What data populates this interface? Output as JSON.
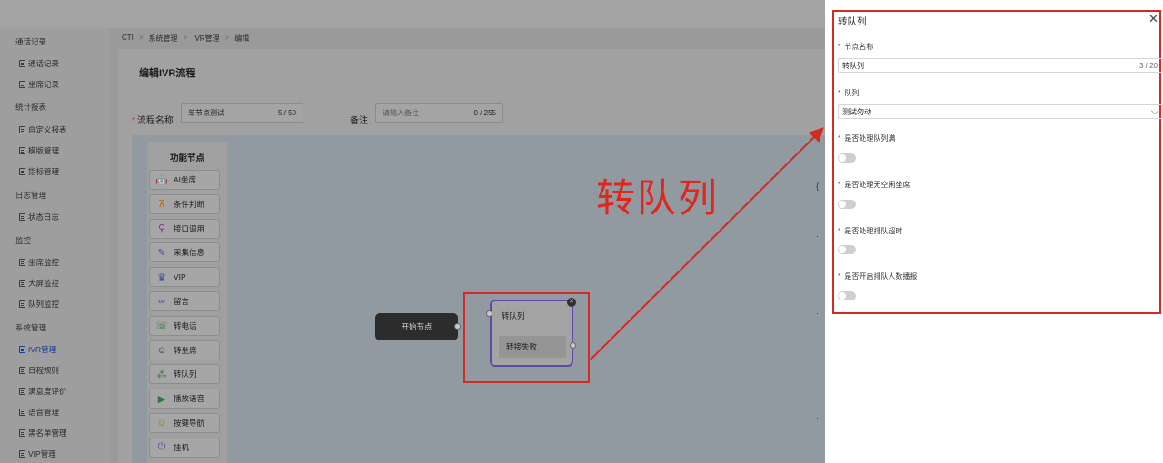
{
  "breadcrumb": [
    "CTI",
    "系统管理",
    "IVR管理",
    "编辑"
  ],
  "page_title": "编辑IVR流程",
  "sidebar": {
    "groups": [
      {
        "label": "通话记录",
        "items": [
          {
            "label": "通话记录"
          },
          {
            "label": "坐席记录"
          }
        ]
      },
      {
        "label": "统计报表",
        "items": [
          {
            "label": "自定义报表"
          },
          {
            "label": "模版管理"
          },
          {
            "label": "指标管理"
          }
        ]
      },
      {
        "label": "日志管理",
        "items": [
          {
            "label": "状态日志"
          }
        ]
      },
      {
        "label": "监控",
        "items": [
          {
            "label": "坐席监控"
          },
          {
            "label": "大屏监控"
          },
          {
            "label": "队列监控"
          }
        ]
      },
      {
        "label": "系统管理",
        "items": [
          {
            "label": "IVR管理",
            "active": true
          },
          {
            "label": "日程规则"
          },
          {
            "label": "满意度评价"
          },
          {
            "label": "语音管理"
          },
          {
            "label": "黑名单管理"
          },
          {
            "label": "VIP管理"
          }
        ]
      }
    ]
  },
  "form": {
    "flow_name_label": "流程名称",
    "flow_name_value": "单节点测试",
    "flow_name_count": "5 / 50",
    "remark_label": "备注",
    "remark_placeholder": "请输入备注",
    "remark_count": "0 / 255"
  },
  "palette": {
    "title": "功能节点",
    "items": [
      {
        "label": "AI坐席",
        "icon": "robot-icon",
        "glyph": "🤖",
        "color": "#b5651d"
      },
      {
        "label": "条件判断",
        "icon": "branch-icon",
        "glyph": "⊼",
        "color": "#b5651d"
      },
      {
        "label": "接口调用",
        "icon": "link-icon",
        "glyph": "⚲",
        "color": "#7a2f8f"
      },
      {
        "label": "采集信息",
        "icon": "collect-icon",
        "glyph": "✎",
        "color": "#3a4a9a"
      },
      {
        "label": "VIP",
        "icon": "vip-icon",
        "glyph": "♛",
        "color": "#3a4a9a"
      },
      {
        "label": "留言",
        "icon": "voicemail-icon",
        "glyph": "∞",
        "color": "#3a4a9a"
      },
      {
        "label": "转电话",
        "icon": "phone-icon",
        "glyph": "☏",
        "color": "#2e7a3a"
      },
      {
        "label": "转坐席",
        "icon": "agent-icon",
        "glyph": "☺",
        "color": "#333333"
      },
      {
        "label": "转队列",
        "icon": "queue-icon",
        "glyph": "⁂",
        "color": "#2e7a3a"
      },
      {
        "label": "播放语音",
        "icon": "play-icon",
        "glyph": "▶",
        "color": "#2e7a3a"
      },
      {
        "label": "按键导航",
        "icon": "keypad-icon",
        "glyph": "☺",
        "color": "#8a7a1a"
      },
      {
        "label": "挂机",
        "icon": "power-icon",
        "glyph": "⏻",
        "color": "#5e4aa8"
      }
    ]
  },
  "canvas": {
    "start_node_label": "开始节点",
    "queue_node_title": "转队列",
    "queue_node_fail": "转接失败",
    "caption": "转队列"
  },
  "drawer": {
    "title": "转队列",
    "node_name_label": "节点名称",
    "node_name_value": "转队列",
    "node_name_count": "3 / 20",
    "queue_label": "队列",
    "queue_value": "测试勿动",
    "toggles": [
      {
        "label": "是否处理队列满",
        "on": false
      },
      {
        "label": "是否处理无空闲坐席",
        "on": false
      },
      {
        "label": "是否处理排队超时",
        "on": false
      },
      {
        "label": "是否开启排队人数播报",
        "on": false
      }
    ]
  },
  "colors": {
    "accent": "#5e4aa8",
    "annotation": "#d42a22",
    "required": "#e1261c"
  }
}
